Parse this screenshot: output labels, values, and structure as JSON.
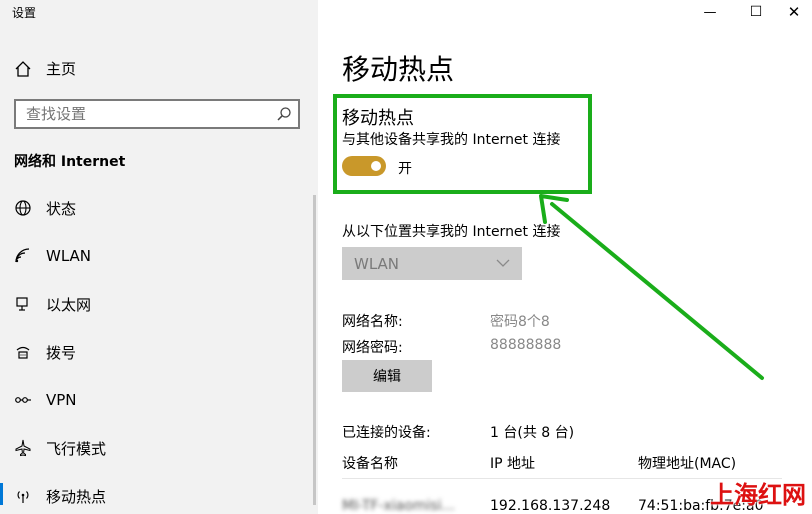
{
  "window": {
    "title": "设置",
    "minimize": "—",
    "maximize": "☐",
    "close": "✕"
  },
  "sidebar": {
    "home": {
      "label": "主页",
      "icon": "home-icon"
    },
    "search": {
      "placeholder": "查找设置",
      "icon": "search-icon"
    },
    "section_title": "网络和 Internet",
    "items": [
      {
        "label": "状态",
        "icon": "globe-icon"
      },
      {
        "label": "WLAN",
        "icon": "wifi-icon"
      },
      {
        "label": "以太网",
        "icon": "ethernet-icon"
      },
      {
        "label": "拨号",
        "icon": "dialup-icon"
      },
      {
        "label": "VPN",
        "icon": "vpn-icon"
      },
      {
        "label": "飞行模式",
        "icon": "airplane-icon"
      },
      {
        "label": "移动热点",
        "icon": "hotspot-icon",
        "active": true
      }
    ]
  },
  "main": {
    "page_title": "移动热点",
    "hotspot": {
      "title": "移动热点",
      "description": "与其他设备共享我的 Internet 连接",
      "toggle_state": "开",
      "toggle_on": true,
      "toggle_color": "#c9982a"
    },
    "share_from": {
      "label": "从以下位置共享我的 Internet 连接",
      "selected": "WLAN"
    },
    "network_name": {
      "label": "网络名称:",
      "value": "密码8个8"
    },
    "network_password": {
      "label": "网络密码:",
      "value": "88888888"
    },
    "edit_button": "编辑",
    "connected": {
      "label": "已连接的设备:",
      "value": "1 台(共 8 台)"
    },
    "table": {
      "headers": [
        "设备名称",
        "IP 地址",
        "物理地址(MAC)"
      ],
      "rows": [
        [
          "MI-TF-xiaomisi...",
          "192.168.137.248",
          "74:51:ba:fb:7e:a0"
        ]
      ]
    }
  },
  "watermark": "上海红网",
  "colors": {
    "highlight": "#1aad1a",
    "accent": "#0078d7"
  }
}
